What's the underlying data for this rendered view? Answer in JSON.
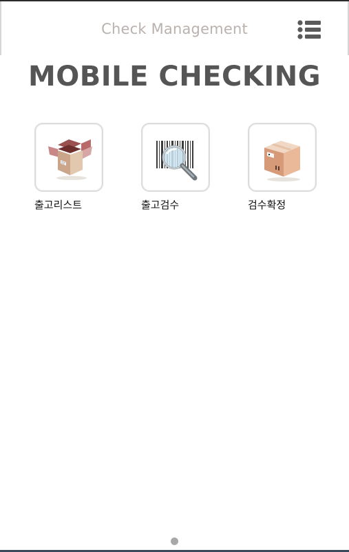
{
  "header": {
    "title": "Check Management",
    "menu_icon": "list-menu-icon"
  },
  "main": {
    "title": "MOBILE CHECKING",
    "tiles": [
      {
        "label": "출고리스트",
        "icon": "open-box-icon"
      },
      {
        "label": "출고검수",
        "icon": "barcode-search-icon"
      },
      {
        "label": "검수확정",
        "icon": "package-icon"
      }
    ]
  },
  "pager": {
    "pages": 1,
    "current": 1
  },
  "colors": {
    "header_title": "#b9b2ae",
    "main_title": "#555555",
    "menu_icon": "#5a5a5a",
    "tile_border": "#dcdcdc"
  }
}
